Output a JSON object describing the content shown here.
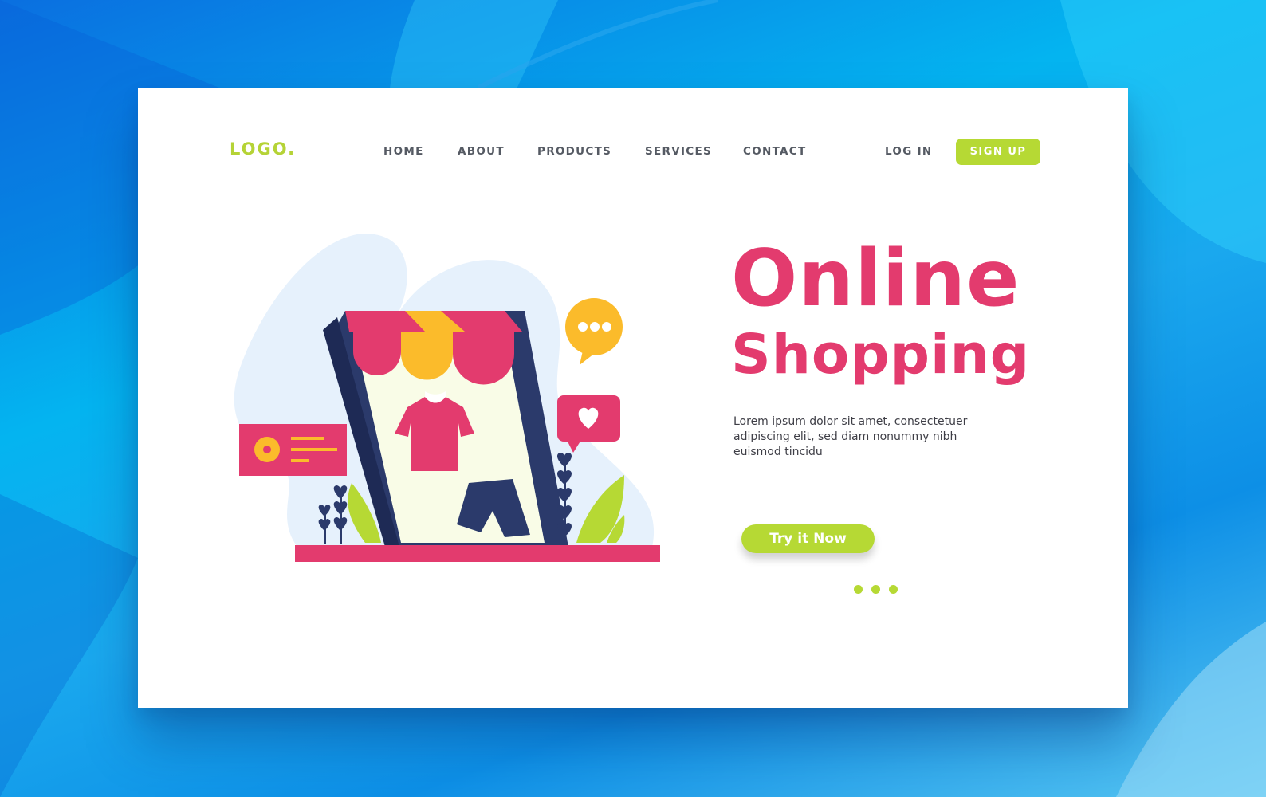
{
  "brand": {
    "logo_text": "LOGO."
  },
  "nav": {
    "items": [
      {
        "label": "HOME"
      },
      {
        "label": "ABOUT"
      },
      {
        "label": "PRODUCTS"
      },
      {
        "label": "SERVICES"
      },
      {
        "label": "CONTACT"
      }
    ],
    "login_label": "LOG IN",
    "signup_label": "SIGN UP"
  },
  "hero": {
    "title_line1": "Online",
    "title_line2": "Shopping",
    "description": "Lorem ipsum dolor sit amet, consectetuer adipiscing elit, sed diam nonummy nibh euismod tincidu",
    "cta_label": "Try it Now"
  },
  "carousel": {
    "dot_count": 3,
    "active_index": 0
  },
  "illustration": {
    "icons": [
      "store-awning-icon",
      "tshirt-icon",
      "shorts-icon",
      "chat-bubble-icon",
      "heart-bubble-icon",
      "product-card-icon",
      "leaf-icon"
    ]
  },
  "colors": {
    "accent_green": "#b6d934",
    "accent_pink": "#e33b6e",
    "accent_yellow": "#fbbb2b",
    "navy": "#2b3a6b",
    "blob_blue": "#e6f1fc"
  }
}
